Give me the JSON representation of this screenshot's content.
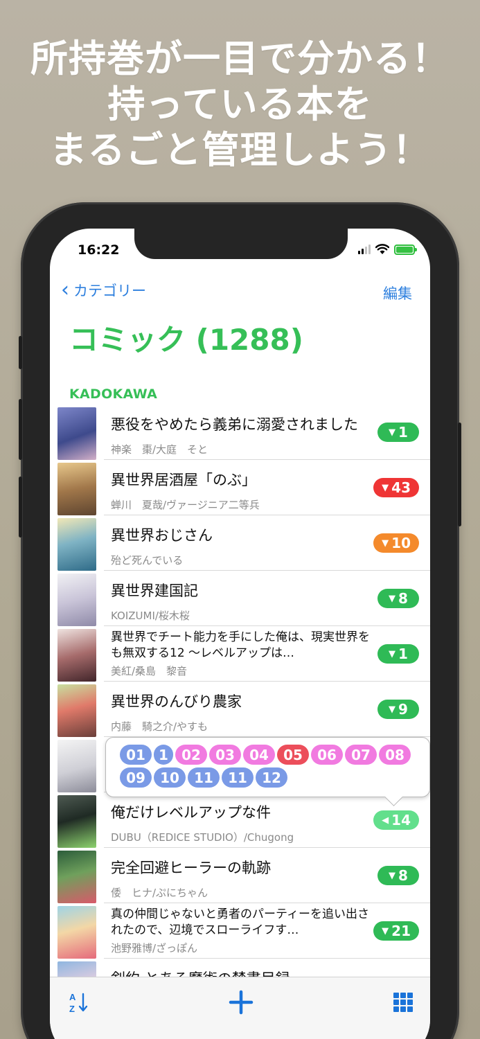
{
  "headline": {
    "line1": "所持巻が一目で分かる！",
    "line2": "持っている本を",
    "line3": "まるごと管理しよう！"
  },
  "status_bar": {
    "time": "16:22"
  },
  "nav": {
    "back_label": "カテゴリー",
    "edit_label": "編集"
  },
  "title": "コミック (1288)",
  "section": "KADOKAWA",
  "books": [
    {
      "title": "悪役をやめたら義弟に溺愛されました",
      "author": "神楽　棗/大庭　そと",
      "count": "1",
      "badge_color": "#2fba56",
      "arrow": "▼"
    },
    {
      "title": "異世界居酒屋「のぶ」",
      "author": "蝉川　夏哉/ヴァージニア二等兵",
      "count": "43",
      "badge_color": "#ef3535",
      "arrow": "▼"
    },
    {
      "title": "異世界おじさん",
      "author": "殆ど死んでいる",
      "count": "10",
      "badge_color": "#f48a2c",
      "arrow": "▼"
    },
    {
      "title": "異世界建国記",
      "author": "KOIZUMI/桜木桜",
      "count": "8",
      "badge_color": "#2fba56",
      "arrow": "▼"
    },
    {
      "title": "異世界でチート能力を手にした俺は、現実世界をも無双する12 〜レベルアップは…",
      "author": "美紅/桑島　黎音",
      "count": "1",
      "badge_color": "#2fba56",
      "arrow": "▼"
    },
    {
      "title": "異世界のんびり農家",
      "author": "内藤　騎之介/やすも",
      "count": "9",
      "badge_color": "#2fba56",
      "arrow": "▼"
    },
    {
      "title": "",
      "author": "",
      "count": "",
      "badge_color": "",
      "arrow": ""
    },
    {
      "title": "俺だけレベルアップな件",
      "author": "DUBU（REDICE STUDIO）/Chugong",
      "count": "14",
      "badge_color": "#62df8c",
      "arrow": "◀"
    },
    {
      "title": "完全回避ヒーラーの軌跡",
      "author": "倭　ヒナ/ぷにちゃん",
      "count": "8",
      "badge_color": "#2fba56",
      "arrow": "▼"
    },
    {
      "title": "真の仲間じゃないと勇者のパーティーを追い出されたので、辺境でスローライフす…",
      "author": "池野雅博/ざっぽん",
      "count": "21",
      "badge_color": "#2fba56",
      "arrow": "▼"
    },
    {
      "title": "剣約 とある魔術の禁書目録",
      "author": "",
      "count": "",
      "badge_color": "#2fba56",
      "arrow": ""
    }
  ],
  "volumes_popup": [
    {
      "label": "01",
      "color": "blue"
    },
    {
      "label": "1",
      "color": "blue"
    },
    {
      "label": "02",
      "color": "pink"
    },
    {
      "label": "03",
      "color": "pink"
    },
    {
      "label": "04",
      "color": "pink"
    },
    {
      "label": "05",
      "color": "red"
    },
    {
      "label": "06",
      "color": "pink"
    },
    {
      "label": "07",
      "color": "pink"
    },
    {
      "label": "08",
      "color": "pink"
    },
    {
      "label": "09",
      "color": "blue"
    },
    {
      "label": "10",
      "color": "blue"
    },
    {
      "label": "11",
      "color": "blue"
    },
    {
      "label": "11",
      "color": "blue"
    },
    {
      "label": "12",
      "color": "blue"
    }
  ],
  "toolbar": {
    "sort_icon": "sort-az-icon",
    "add_icon": "plus-icon",
    "grid_icon": "grid-icon"
  },
  "colors": {
    "accent_green": "#36bf57",
    "link_blue": "#2d7fde",
    "toolbar_blue": "#1a73d9"
  }
}
